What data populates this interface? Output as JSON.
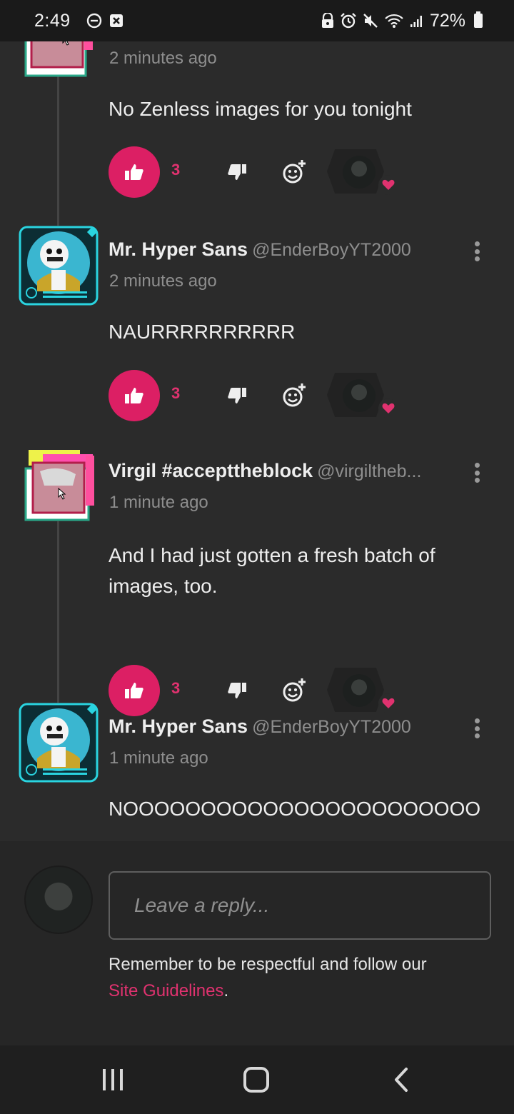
{
  "status_bar": {
    "time": "2:49",
    "battery": "72%"
  },
  "comments": [
    {
      "username": "",
      "handle": "",
      "timestamp": "2 minutes ago",
      "text": "No Zenless images for you tonight",
      "likes": "3"
    },
    {
      "username": "Mr. Hyper Sans",
      "handle": "@EnderBoyYT2000",
      "timestamp": "2 minutes ago",
      "text": "NAURRRRRRRRRR",
      "likes": "3"
    },
    {
      "username": "Virgil #accepttheblock",
      "handle": "@virgiltheb...",
      "timestamp": "1 minute ago",
      "text": "And I had just gotten a fresh batch of images, too.",
      "likes": "3"
    },
    {
      "username": "Mr. Hyper Sans",
      "handle": "@EnderBoyYT2000",
      "timestamp": "1 minute ago",
      "text": "NOOOOOOOOOOOOOOOOOOOOOOO"
    }
  ],
  "reply": {
    "placeholder": "Leave a reply...",
    "guidelines_prefix": "Remember to be respectful and follow our",
    "guidelines_link": "Site Guidelines",
    "guidelines_suffix": "."
  },
  "colors": {
    "accent": "#dc1f64",
    "background": "#2b2b2b",
    "muted_text": "#8e8e8e"
  }
}
